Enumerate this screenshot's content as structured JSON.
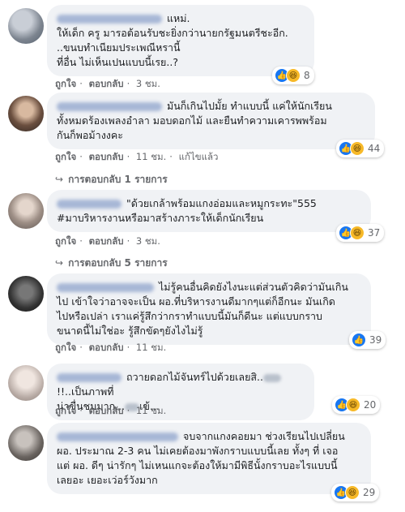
{
  "meta": {
    "like": "ถูกใจ",
    "reply": "ตอบกลับ",
    "edited": "แก้ไขแล้ว",
    "sep": "·"
  },
  "reactions_icons": [
    "thumbs-up-icon",
    "laughing-emoji-icon"
  ],
  "colors": {
    "like": "#1877f2",
    "haha": "#f7b928",
    "bubble": "#f0f2f5"
  },
  "comments": [
    {
      "text": "แหม่.\nให้เด็ก ครู มารอต้อนรับชะยิ่งกว่านายกรัฐมนตรีชะอีก.\n..ขนบทำเนียมประเพณีหรานี้\nที่อื่น ไม่เห็นเปนแบบนี้เรย..?",
      "time": "3 ชม.",
      "count": "8"
    },
    {
      "text": "มันก็เกินไปมั้ย ทำแบบนี้ แค่ให้นักเรียน\nทั้งหมดร้องเพลงอำลา มอบดอกไม้ และยืนทำความเคารพพร้อม\nกันก็พอม้างงคะ",
      "time": "11 ชม.",
      "count": "44",
      "replies": "การตอบกลับ 1 รายการ"
    },
    {
      "text": "\"ด้วยเกล้าพร้อมแกงอ่อมและหมูกระทะ\"555\n#มาบริหารงานหรือมาสร้างภาระให้เด็กนักเรียน",
      "time": "3 ชม.",
      "count": "37",
      "replies": "การตอบกลับ 5 รายการ"
    },
    {
      "text": "ไม่รู้คนอื่นคิดยังไงนะแต่ส่วนตัวคิดว่ามันเกิน\nไป เข้าใจว่าอาจจะเป็น ผอ.ที่บริหารงานดีมากๆแต่ก็อีกนะ มันเกิด\nไปหรือเปล่า เราแค่รู้สึกว่ากราทำแบบนี้มันก็ดีนะ แต่แบบกราบ\nขนาดนี้ไม่ใช่อะ รู้สึกขัดๆยังไงไม่รู้",
      "time": "11 ชม.",
      "count": "39"
    },
    {
      "text_a": "ถวายดอกไม้จันทร์ไปด้วยเลยสิ..",
      "text_b": "!!..เป็นภาพที่\nน่าขื่นชมมาก...",
      "text_c": "เข้...",
      "time": "11 ชม.",
      "count": "20"
    },
    {
      "text": "จบจากแกงคอยมา ช่วงเรียนไปเปลี่ยน\nผอ. ประมาณ 2-3 คน ไม่เคยต้องมาพังกราบแบบนี้เลย ทั้งๆ ที่ เจอ\nแต่ ผอ. ดีๆ น่ารักๆ ไม่เหนแกจะต้องให้มามีพิธีนั้งกราบอะไรแบบนี้\nเลยอะ เยอะเว่อร์วังมาก",
      "time": "11 ชม.",
      "count": "29"
    }
  ]
}
